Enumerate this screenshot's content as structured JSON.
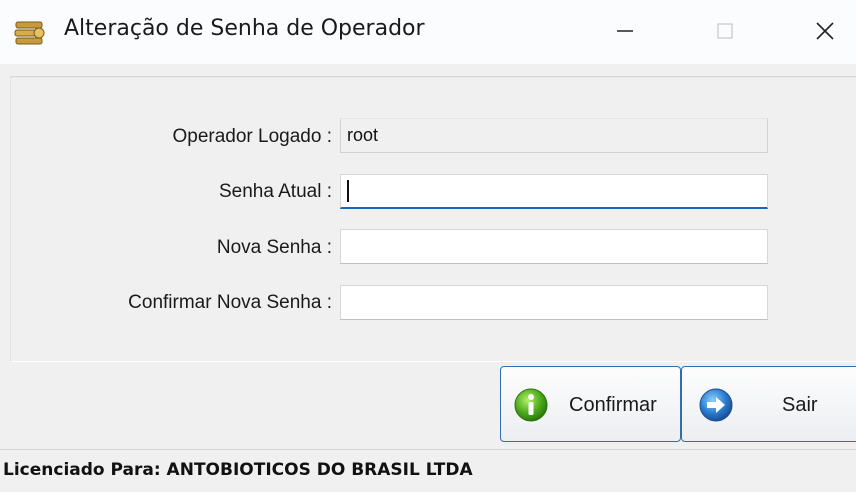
{
  "window": {
    "title": "Alteração de Senha de Operador",
    "icon": "operator-cash-icon"
  },
  "titlebar_buttons": {
    "minimize": "minimize-icon",
    "maximize": "maximize-icon",
    "close": "close-icon"
  },
  "form": {
    "operator_label": "Operador Logado :",
    "operator_value": "root",
    "current_password_label": "Senha Atual :",
    "current_password_value": "",
    "new_password_label": "Nova Senha :",
    "new_password_value": "",
    "confirm_password_label": "Confirmar Nova Senha :",
    "confirm_password_value": ""
  },
  "buttons": {
    "confirm_label": "Confirmar",
    "confirm_icon": "info-green-icon",
    "exit_label": "Sair",
    "exit_icon": "arrow-right-blue-icon"
  },
  "status": {
    "text": "Licenciado Para: ANTOBIOTICOS DO BRASIL LTDA"
  },
  "colors": {
    "focus_underline": "#1767c0",
    "button_border": "#2e6fb4"
  }
}
